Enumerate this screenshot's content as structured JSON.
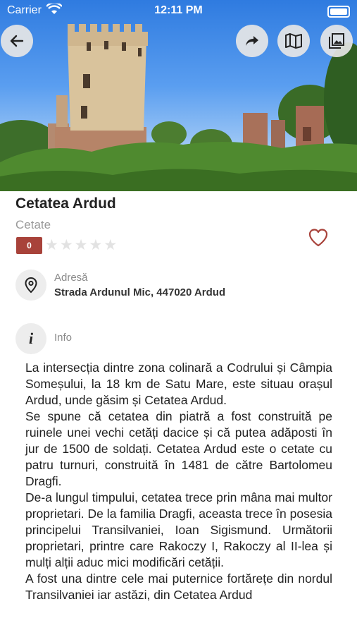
{
  "status_bar": {
    "carrier": "Carrier",
    "time": "12:11 PM"
  },
  "hero": {
    "image": "castle-tower-ruins-photo"
  },
  "header_buttons": {
    "back": "back-arrow-icon",
    "share": "share-icon",
    "map": "map-icon",
    "gallery": "gallery-icon"
  },
  "place": {
    "name": "Cetatea Ardud",
    "category": "Cetate",
    "rating": "0",
    "stars_total": 5,
    "stars_filled": 0
  },
  "address": {
    "label": "Adresă",
    "value": "Strada Ardunul Mic, 447020 Ardud"
  },
  "info": {
    "label": "Info",
    "paragraphs": [
      "La intersecția dintre zona colinară a Codrului și Câmpia Someșului, la 18 km de Satu Mare, este situau orașul Ardud, unde găsim și Cetatea Ardud.",
      "Se spune că cetatea din piatră a fost construită pe ruinele unei vechi cetăți dacice și că putea adăposti în jur de 1500 de soldați. Cetatea Ardud este o cetate cu patru turnuri, construită în 1481 de către Bartolomeu Dragfi.",
      "De-a lungul timpului, cetatea trece prin mâna mai multor proprietari. De la familia Dragfi, aceasta trece în posesia principelui Transilvaniei, Ioan Sigismund. Următorii proprietari, printre care Rakoczy I, Rakoczy al II-lea și mulți alții aduc mici modificări cetății.",
      "A fost una dintre cele mai puternice fortărețe din nordul Transilvaniei iar astăzi, din Cetatea Ardud"
    ]
  },
  "colors": {
    "accent": "#a8423a",
    "muted": "#9a9a9a"
  }
}
